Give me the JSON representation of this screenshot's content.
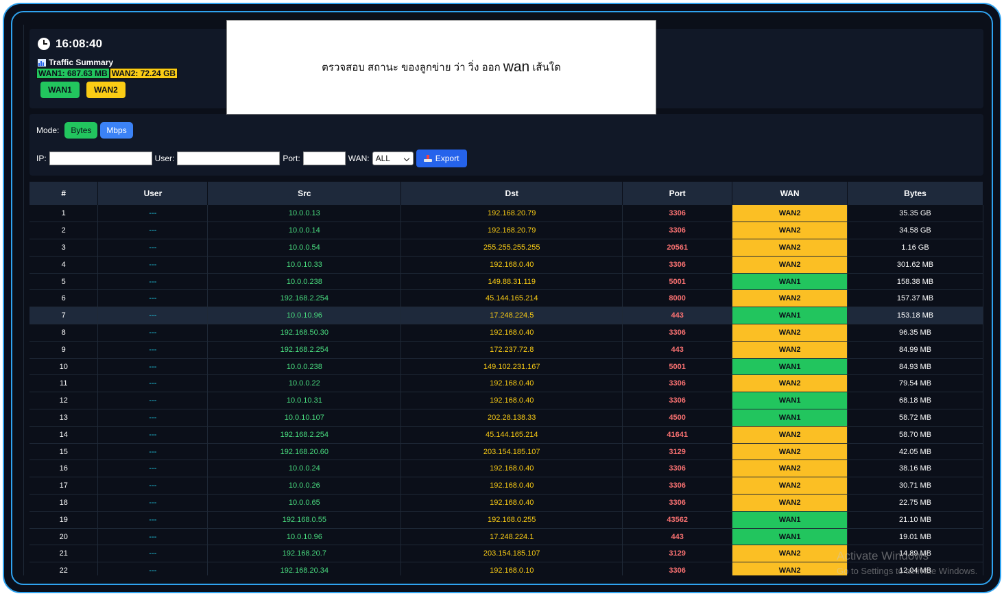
{
  "clock": {
    "time": "16:08:40"
  },
  "summary": {
    "title": "Traffic Summary",
    "wan1": "WAN1: 687.63 MB",
    "wan2": "WAN2: 72.24 GB"
  },
  "wan_buttons": {
    "wan1": "WAN1",
    "wan2": "WAN2"
  },
  "notice": {
    "before": "ตรวจสอบ สถานะ ของลูกข่าย ว่า วิ่ง ออก",
    "big": "wan",
    "after": "เส้นใด"
  },
  "mode": {
    "label": "Mode:",
    "bytes": "Bytes",
    "mbps": "Mbps"
  },
  "filters": {
    "ip_label": "IP:",
    "user_label": "User:",
    "port_label": "Port:",
    "wan_label": "WAN:",
    "wan_selected": "ALL",
    "export_label": "Export"
  },
  "table": {
    "headers": [
      "#",
      "User",
      "Src",
      "Dst",
      "Port",
      "WAN",
      "Bytes"
    ],
    "rows": [
      {
        "n": "1",
        "user": "---",
        "src": "10.0.0.13",
        "dst": "192.168.20.79",
        "port": "3306",
        "wan": "WAN2",
        "bytes": "35.35 GB"
      },
      {
        "n": "2",
        "user": "---",
        "src": "10.0.0.14",
        "dst": "192.168.20.79",
        "port": "3306",
        "wan": "WAN2",
        "bytes": "34.58 GB"
      },
      {
        "n": "3",
        "user": "---",
        "src": "10.0.0.54",
        "dst": "255.255.255.255",
        "port": "20561",
        "wan": "WAN2",
        "bytes": "1.16 GB"
      },
      {
        "n": "4",
        "user": "---",
        "src": "10.0.10.33",
        "dst": "192.168.0.40",
        "port": "3306",
        "wan": "WAN2",
        "bytes": "301.62 MB"
      },
      {
        "n": "5",
        "user": "---",
        "src": "10.0.0.238",
        "dst": "149.88.31.119",
        "port": "5001",
        "wan": "WAN1",
        "bytes": "158.38 MB"
      },
      {
        "n": "6",
        "user": "---",
        "src": "192.168.2.254",
        "dst": "45.144.165.214",
        "port": "8000",
        "wan": "WAN2",
        "bytes": "157.37 MB"
      },
      {
        "n": "7",
        "user": "---",
        "src": "10.0.10.96",
        "dst": "17.248.224.5",
        "port": "443",
        "wan": "WAN1",
        "bytes": "153.18 MB"
      },
      {
        "n": "8",
        "user": "---",
        "src": "192.168.50.30",
        "dst": "192.168.0.40",
        "port": "3306",
        "wan": "WAN2",
        "bytes": "96.35 MB"
      },
      {
        "n": "9",
        "user": "---",
        "src": "192.168.2.254",
        "dst": "172.237.72.8",
        "port": "443",
        "wan": "WAN2",
        "bytes": "84.99 MB"
      },
      {
        "n": "10",
        "user": "---",
        "src": "10.0.0.238",
        "dst": "149.102.231.167",
        "port": "5001",
        "wan": "WAN1",
        "bytes": "84.93 MB"
      },
      {
        "n": "11",
        "user": "---",
        "src": "10.0.0.22",
        "dst": "192.168.0.40",
        "port": "3306",
        "wan": "WAN2",
        "bytes": "79.54 MB"
      },
      {
        "n": "12",
        "user": "---",
        "src": "10.0.10.31",
        "dst": "192.168.0.40",
        "port": "3306",
        "wan": "WAN1",
        "bytes": "68.18 MB"
      },
      {
        "n": "13",
        "user": "---",
        "src": "10.0.10.107",
        "dst": "202.28.138.33",
        "port": "4500",
        "wan": "WAN1",
        "bytes": "58.72 MB"
      },
      {
        "n": "14",
        "user": "---",
        "src": "192.168.2.254",
        "dst": "45.144.165.214",
        "port": "41641",
        "wan": "WAN2",
        "bytes": "58.70 MB"
      },
      {
        "n": "15",
        "user": "---",
        "src": "192.168.20.60",
        "dst": "203.154.185.107",
        "port": "3129",
        "wan": "WAN2",
        "bytes": "42.05 MB"
      },
      {
        "n": "16",
        "user": "---",
        "src": "10.0.0.24",
        "dst": "192.168.0.40",
        "port": "3306",
        "wan": "WAN2",
        "bytes": "38.16 MB"
      },
      {
        "n": "17",
        "user": "---",
        "src": "10.0.0.26",
        "dst": "192.168.0.40",
        "port": "3306",
        "wan": "WAN2",
        "bytes": "30.71 MB"
      },
      {
        "n": "18",
        "user": "---",
        "src": "10.0.0.65",
        "dst": "192.168.0.40",
        "port": "3306",
        "wan": "WAN2",
        "bytes": "22.75 MB"
      },
      {
        "n": "19",
        "user": "---",
        "src": "192.168.0.55",
        "dst": "192.168.0.255",
        "port": "43562",
        "wan": "WAN1",
        "bytes": "21.10 MB"
      },
      {
        "n": "20",
        "user": "---",
        "src": "10.0.10.96",
        "dst": "17.248.224.1",
        "port": "443",
        "wan": "WAN1",
        "bytes": "19.01 MB"
      },
      {
        "n": "21",
        "user": "---",
        "src": "192.168.20.7",
        "dst": "203.154.185.107",
        "port": "3129",
        "wan": "WAN2",
        "bytes": "14.89 MB"
      },
      {
        "n": "22",
        "user": "---",
        "src": "192.168.20.34",
        "dst": "192.168.0.10",
        "port": "3306",
        "wan": "WAN2",
        "bytes": "12.04 MB"
      }
    ],
    "highlighted_row": 7
  },
  "watermark": {
    "title": "Activate Windows",
    "subtitle": "Go to Settings to activate Windows."
  },
  "colors": {
    "accent_border": "#2fa3f0",
    "wan1": "#22c55e",
    "wan2": "#fbbf24",
    "background": "#0b0f19"
  },
  "icons": {
    "clock": "clock-icon",
    "summary": "bar-chart-icon",
    "export": "download-tray-icon"
  }
}
